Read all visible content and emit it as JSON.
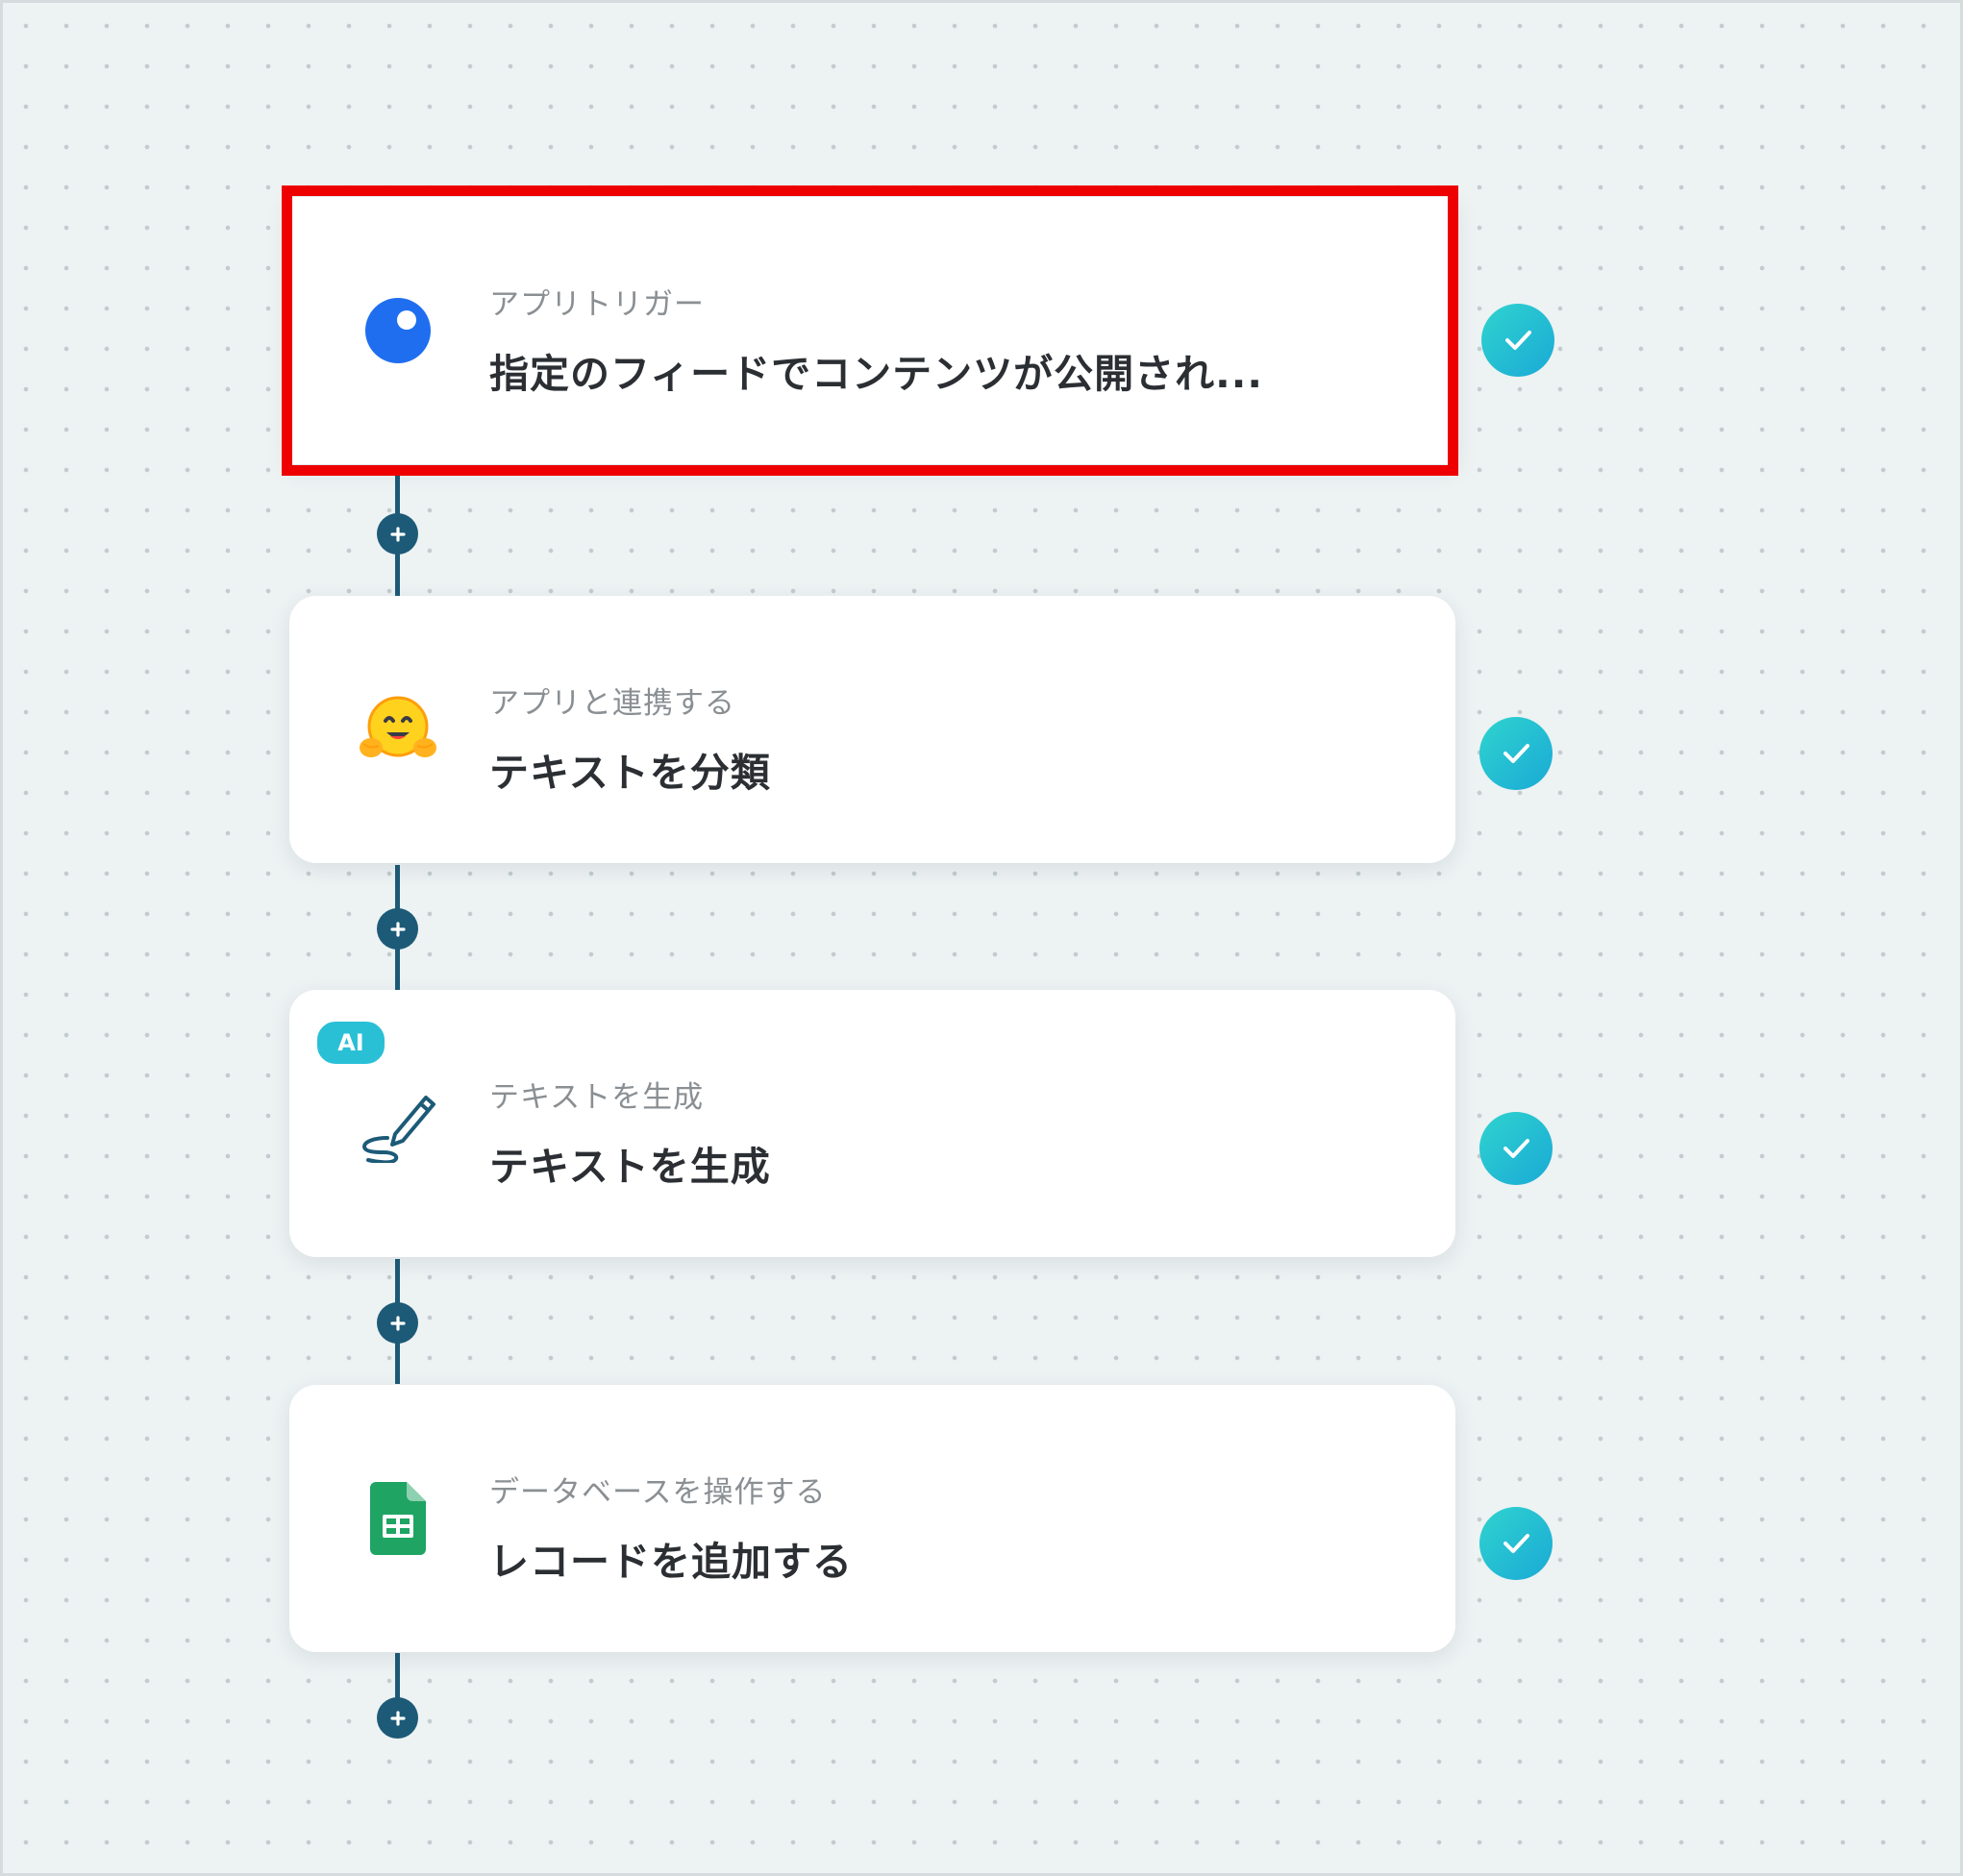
{
  "workflow": {
    "steps": [
      {
        "category": "アプリトリガー",
        "title": "指定のフィードでコンテンツが公開され...",
        "icon": "rss-trigger-icon",
        "status": "completed",
        "highlighted": true
      },
      {
        "category": "アプリと連携する",
        "title": "テキストを分類",
        "icon": "hugging-face-icon",
        "status": "completed"
      },
      {
        "category": "テキストを生成",
        "title": "テキストを生成",
        "icon": "pen-write-icon",
        "badge": "AI",
        "status": "completed"
      },
      {
        "category": "データベースを操作する",
        "title": "レコードを追加する",
        "icon": "google-sheets-icon",
        "status": "completed"
      }
    ]
  },
  "colors": {
    "background": "#edf2f3",
    "connector": "#1c5a77",
    "highlight": "#ee0000",
    "check_gradient_start": "#2fd4cf",
    "check_gradient_end": "#1aa9d6",
    "ai_badge": "#29c0d6"
  }
}
